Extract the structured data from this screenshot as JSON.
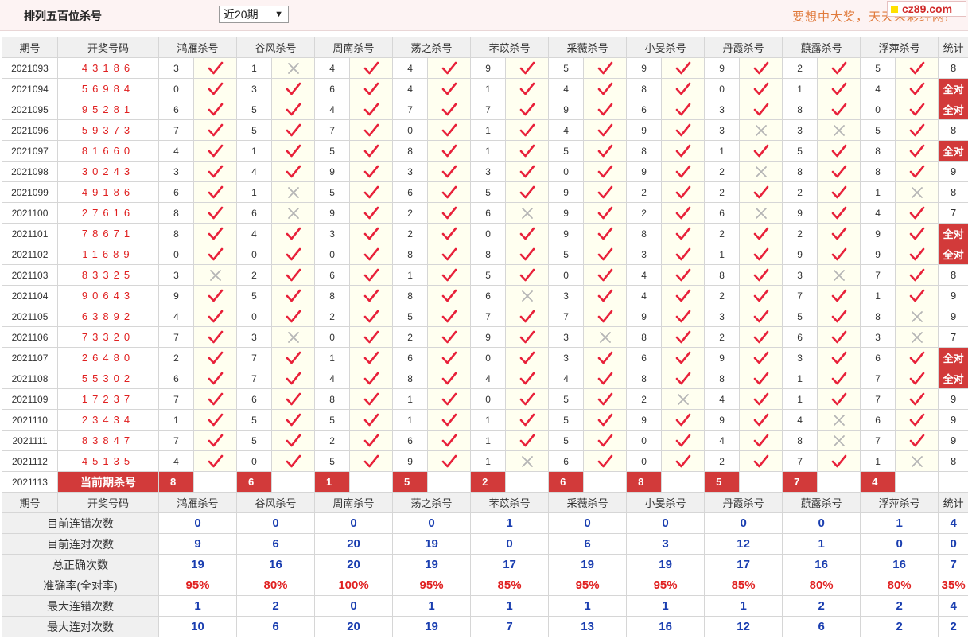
{
  "header": {
    "title": "排列五百位杀号",
    "period_select": "近20期",
    "slogan": "要想中大奖，天天来彩经网!",
    "site_logo": "cz89.com"
  },
  "columns": {
    "period": "期号",
    "draw": "开奖号码",
    "experts": [
      "鸿雁杀号",
      "谷风杀号",
      "周南杀号",
      "荡之杀号",
      "芣苡杀号",
      "采薇杀号",
      "小旻杀号",
      "丹霞杀号",
      "蕻露杀号",
      "浮萍杀号"
    ],
    "stat": "统计"
  },
  "rows": [
    {
      "period": "2021093",
      "draw": "43186",
      "kills": [
        3,
        1,
        4,
        4,
        9,
        5,
        9,
        9,
        2,
        5
      ],
      "marks": "10111111111",
      "stat": "8",
      "m": "1011111111"
    },
    {
      "period": "2021094",
      "draw": "56984",
      "kills": [
        0,
        3,
        6,
        4,
        1,
        4,
        8,
        0,
        1,
        4
      ],
      "m": "1111111111",
      "stat": "全对"
    },
    {
      "period": "2021095",
      "draw": "95281",
      "kills": [
        6,
        5,
        4,
        7,
        7,
        9,
        6,
        3,
        8,
        0
      ],
      "m": "1111111111",
      "stat": "全对"
    },
    {
      "period": "2021096",
      "draw": "59373",
      "kills": [
        7,
        5,
        7,
        0,
        1,
        4,
        9,
        3,
        3,
        5
      ],
      "m": "1111111001",
      "stat": "8"
    },
    {
      "period": "2021097",
      "draw": "81660",
      "kills": [
        4,
        1,
        5,
        8,
        1,
        5,
        8,
        1,
        5,
        8
      ],
      "m": "1111111111",
      "stat": "全对"
    },
    {
      "period": "2021098",
      "draw": "30243",
      "kills": [
        3,
        4,
        9,
        3,
        3,
        0,
        9,
        2,
        8,
        8
      ],
      "m": "1111111011",
      "stat": "9"
    },
    {
      "period": "2021099",
      "draw": "49186",
      "kills": [
        6,
        1,
        5,
        6,
        5,
        9,
        2,
        2,
        2,
        1
      ],
      "m": "1011111110",
      "stat": "8"
    },
    {
      "period": "2021100",
      "draw": "27616",
      "kills": [
        8,
        6,
        9,
        2,
        6,
        9,
        2,
        6,
        9,
        4
      ],
      "m": "1011011011",
      "stat": "7"
    },
    {
      "period": "2021101",
      "draw": "78671",
      "kills": [
        8,
        4,
        3,
        2,
        0,
        9,
        8,
        2,
        2,
        9
      ],
      "m": "1111111111",
      "stat": "全对"
    },
    {
      "period": "2021102",
      "draw": "11689",
      "kills": [
        0,
        0,
        0,
        8,
        8,
        5,
        3,
        1,
        9,
        9
      ],
      "m": "1111111111",
      "stat": "全对"
    },
    {
      "period": "2021103",
      "draw": "83325",
      "kills": [
        3,
        2,
        6,
        1,
        5,
        0,
        4,
        8,
        3,
        7
      ],
      "m": "0111111101",
      "stat": "8"
    },
    {
      "period": "2021104",
      "draw": "90643",
      "kills": [
        9,
        5,
        8,
        8,
        6,
        3,
        4,
        2,
        7,
        1
      ],
      "m": "1111011111",
      "stat": "9"
    },
    {
      "period": "2021105",
      "draw": "63892",
      "kills": [
        4,
        0,
        2,
        5,
        7,
        7,
        9,
        3,
        5,
        8
      ],
      "m": "1111111110",
      "stat": "9"
    },
    {
      "period": "2021106",
      "draw": "73320",
      "kills": [
        7,
        3,
        0,
        2,
        9,
        3,
        8,
        2,
        6,
        3
      ],
      "m": "1011101110",
      "stat": "7"
    },
    {
      "period": "2021107",
      "draw": "26480",
      "kills": [
        2,
        7,
        1,
        6,
        0,
        3,
        6,
        9,
        3,
        6
      ],
      "m": "1111111111",
      "stat": "全对"
    },
    {
      "period": "2021108",
      "draw": "55302",
      "kills": [
        6,
        7,
        4,
        8,
        4,
        4,
        8,
        8,
        1,
        7
      ],
      "m": "1111111111",
      "stat": "全对"
    },
    {
      "period": "2021109",
      "draw": "17237",
      "kills": [
        7,
        6,
        8,
        1,
        0,
        5,
        2,
        4,
        1,
        7
      ],
      "m": "1111110111",
      "stat": "9"
    },
    {
      "period": "2021110",
      "draw": "23434",
      "kills": [
        1,
        5,
        5,
        1,
        1,
        5,
        9,
        9,
        4,
        6
      ],
      "m": "1111111101",
      "stat": "9"
    },
    {
      "period": "2021111",
      "draw": "83847",
      "kills": [
        7,
        5,
        2,
        6,
        1,
        5,
        0,
        4,
        8,
        7
      ],
      "m": "1111111101",
      "stat": "9"
    },
    {
      "period": "2021112",
      "draw": "45135",
      "kills": [
        4,
        0,
        5,
        9,
        1,
        6,
        0,
        2,
        7,
        1
      ],
      "m": "1111011110",
      "stat": "8"
    }
  ],
  "current": {
    "period": "2021113",
    "label": "当前期杀号",
    "kills": [
      "8",
      "6",
      "1",
      "5",
      "2",
      "6",
      "8",
      "5",
      "7",
      "4"
    ]
  },
  "summary": [
    {
      "label": "目前连错次数",
      "values": [
        "0",
        "0",
        "0",
        "0",
        "1",
        "0",
        "0",
        "0",
        "0",
        "1"
      ],
      "stat": "4",
      "red": false
    },
    {
      "label": "目前连对次数",
      "values": [
        "9",
        "6",
        "20",
        "19",
        "0",
        "6",
        "3",
        "12",
        "1",
        "0"
      ],
      "stat": "0",
      "red": false
    },
    {
      "label": "总正确次数",
      "values": [
        "19",
        "16",
        "20",
        "19",
        "17",
        "19",
        "19",
        "17",
        "16",
        "16"
      ],
      "stat": "7",
      "red": false
    },
    {
      "label": "准确率(全对率)",
      "values": [
        "95%",
        "80%",
        "100%",
        "95%",
        "85%",
        "95%",
        "95%",
        "85%",
        "80%",
        "80%"
      ],
      "stat": "35%",
      "red": true
    },
    {
      "label": "最大连错次数",
      "values": [
        "1",
        "2",
        "0",
        "1",
        "1",
        "1",
        "1",
        "1",
        "2",
        "2"
      ],
      "stat": "4",
      "red": false
    },
    {
      "label": "最大连对次数",
      "values": [
        "10",
        "6",
        "20",
        "19",
        "7",
        "13",
        "16",
        "12",
        "6",
        "2"
      ],
      "stat": "2",
      "red": false
    }
  ],
  "icons": {
    "correct": "check-icon",
    "wrong": "cross-icon"
  },
  "colors": {
    "correct": "#e8213a",
    "wrong": "#b5b5b5",
    "highlight": "#d23a3a",
    "summary_value": "#1a3eb0"
  }
}
